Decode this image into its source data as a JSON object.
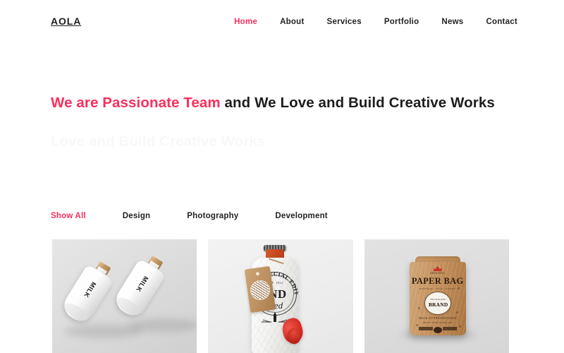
{
  "site": {
    "brand": "AOLA",
    "accent_color": "#fb2e5d",
    "text_color": "#1d1d1d",
    "background": "#ffffff"
  },
  "nav": {
    "items": [
      {
        "label": "Home",
        "active": true
      },
      {
        "label": "About",
        "active": false
      },
      {
        "label": "Services",
        "active": false
      },
      {
        "label": "Portfolio",
        "active": false
      },
      {
        "label": "News",
        "active": false
      },
      {
        "label": "Contact",
        "active": false
      }
    ]
  },
  "hero": {
    "accent_text": "We are Passionate Team",
    "rest_text": " and We Love and Build Creative Works",
    "ghost_text": "Love and Build Creative Works"
  },
  "filters": {
    "items": [
      {
        "label": "Show All",
        "active": true
      },
      {
        "label": "Design",
        "active": false
      },
      {
        "label": "Photography",
        "active": false
      },
      {
        "label": "Development",
        "active": false
      }
    ]
  },
  "portfolio": {
    "items": [
      {
        "name": "milk-bottles",
        "alt": "Two white milk bottles with gold caps",
        "background": "#d8d8d8",
        "label": "MILK"
      },
      {
        "name": "limited-edition-bottle",
        "alt": "Paper wrapped bottle with limited special edition label and kraft tag",
        "background": "#ededed",
        "arc_text": "LIMITED SPECIAL EDITION",
        "est_text": "EST. 1912",
        "brand_primary": "IND",
        "brand_secondary": "Hed"
      },
      {
        "name": "paper-bag-pouch",
        "alt": "Kraft paper stand up pouch with packaging brand badge",
        "background": "#dedede",
        "top_line": "ORIGINAL",
        "title": "PAPER BAG",
        "rule_line": "NATURAL  •  ECO  •  CRAFT",
        "badge_small": "PACKAGING",
        "badge_large": "BRAND",
        "sub_line": "MOCK-UP PRESENTATION",
        "sub_line2": "FRONT VIEW TEMPLATE"
      }
    ]
  }
}
